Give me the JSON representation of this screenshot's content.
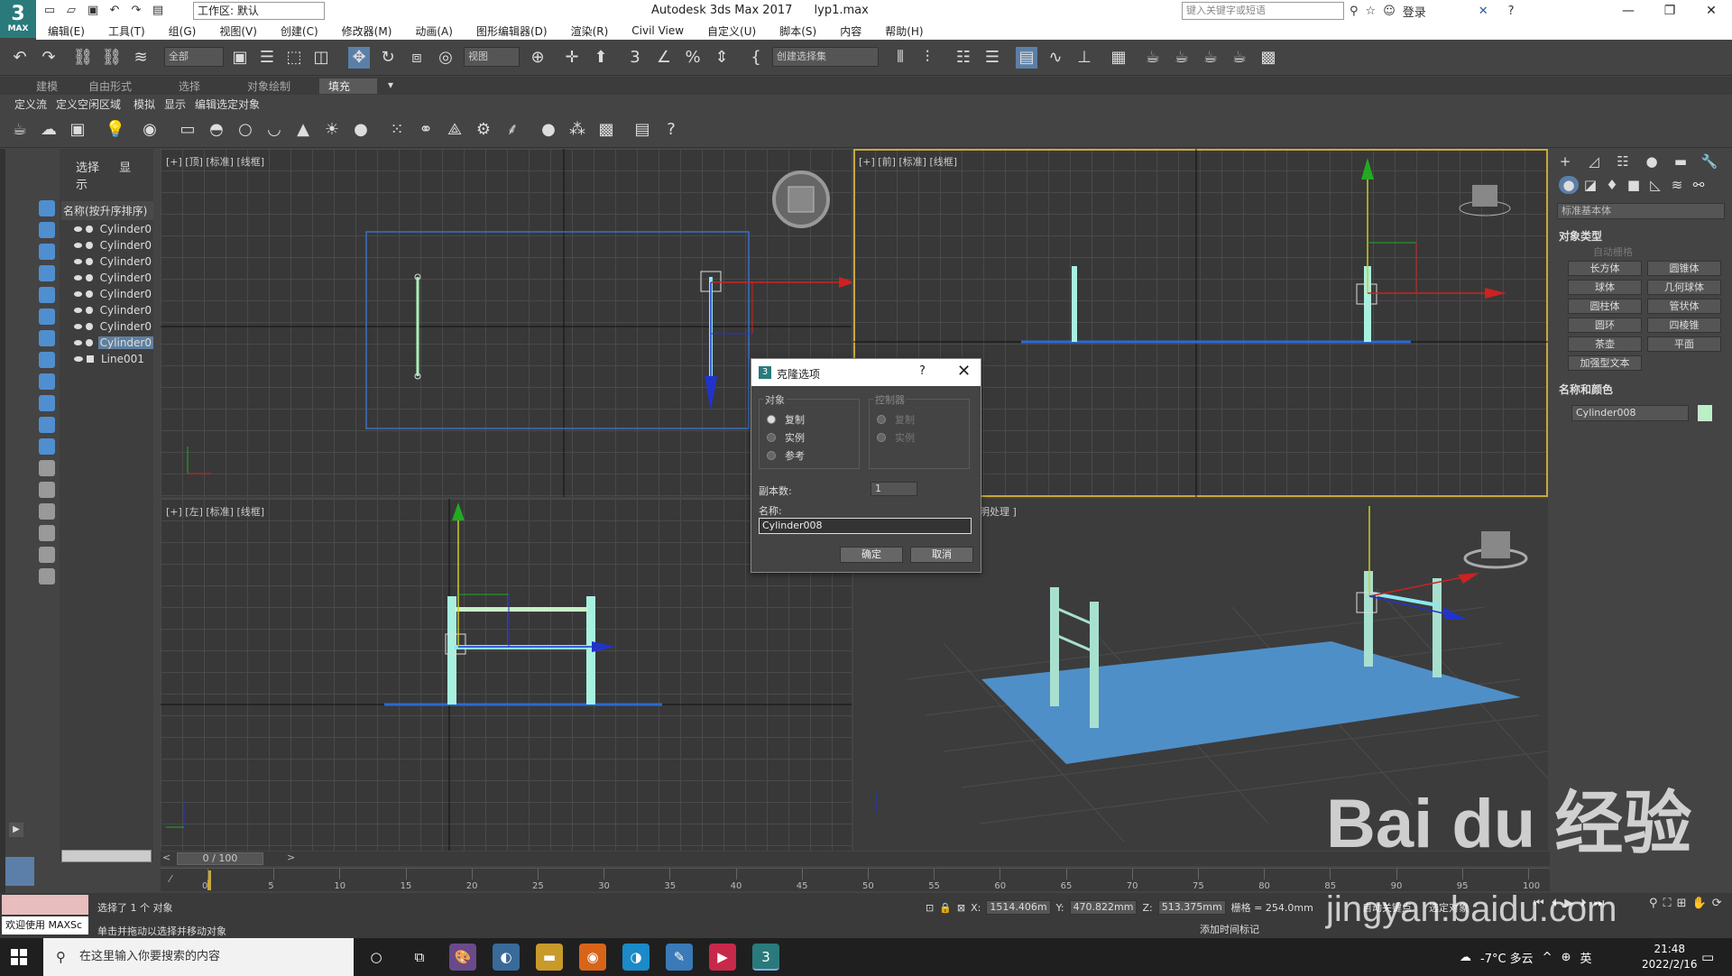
{
  "app": {
    "logo_text": "3",
    "logo_sub": "MAX",
    "workspace": "工作区: 默认",
    "title": "Autodesk 3ds Max 2017",
    "file": "lyp1.max",
    "search_placeholder": "键入关键字或短语",
    "login": "登录"
  },
  "menu": [
    "编辑(E)",
    "工具(T)",
    "组(G)",
    "视图(V)",
    "创建(C)",
    "修改器(M)",
    "动画(A)",
    "图形编辑器(D)",
    "渲染(R)",
    "Civil View",
    "自定义(U)",
    "脚本(S)",
    "内容",
    "帮助(H)"
  ],
  "toolbar": {
    "filter_dropdown": "全部",
    "view_dropdown": "视图",
    "selection_set": "创建选择集"
  },
  "ribbon": {
    "tabs": [
      "建模",
      "自由形式",
      "选择",
      "对象绘制",
      "填充"
    ],
    "active_tab": "填充",
    "subtabs": [
      "定义流",
      "定义空闲区域",
      "模拟",
      "显示",
      "编辑选定对象"
    ]
  },
  "explorer": {
    "tabs": [
      "选择",
      "显示"
    ],
    "header": "名称(按升序排序)",
    "items": [
      "Cylinder0",
      "Cylinder0",
      "Cylinder0",
      "Cylinder0",
      "Cylinder0",
      "Cylinder0",
      "Cylinder0",
      "Cylinder0",
      "Line001"
    ]
  },
  "viewports": {
    "top": "[+] [顶] [标准] [线框]",
    "front": "[+] [前] [标准] [线框]",
    "left": "[+] [左] [标准] [线框]",
    "persp": "明处理 ]"
  },
  "command_panel": {
    "category": "标准基本体",
    "rollout_object_type": "对象类型",
    "autogrid": "自动栅格",
    "buttons": [
      "长方体",
      "圆锥体",
      "球体",
      "几何球体",
      "圆柱体",
      "管状体",
      "圆环",
      "四棱锥",
      "茶壶",
      "平面",
      "加强型文本"
    ],
    "rollout_name_color": "名称和颜色",
    "object_name": "Cylinder008",
    "object_color": "#b9f0c4"
  },
  "dialog": {
    "title": "克隆选项",
    "help": "?",
    "object_group": "对象",
    "object_options": [
      "复制",
      "实例",
      "参考"
    ],
    "selected_option": "复制",
    "controller_group": "控制器",
    "controller_options": [
      "复制",
      "实例"
    ],
    "copies_label": "副本数:",
    "copies_value": "1",
    "name_label": "名称:",
    "name_value": "Cylinder008",
    "ok": "确定",
    "cancel": "取消"
  },
  "timeline": {
    "slider": "0 / 100",
    "ticks": [
      "0",
      "5",
      "10",
      "15",
      "20",
      "25",
      "30",
      "35",
      "40",
      "45",
      "50",
      "55",
      "60",
      "65",
      "70",
      "75",
      "80",
      "85",
      "90",
      "95",
      "100"
    ]
  },
  "status": {
    "maxscript": "欢迎使用 MAXSc",
    "selected": "选择了 1 个 对象",
    "hint": "单击并拖动以选择并移动对象",
    "x_label": "X:",
    "x": "1514.406m",
    "y_label": "Y:",
    "y": "470.822mm",
    "z_label": "Z:",
    "z": "513.375mm",
    "grid": "栅格 = 254.0mm",
    "add_time_tag": "添加时间标记",
    "autokey": "自动关键点",
    "set_key": "选定对象"
  },
  "taskbar": {
    "search": "在这里输入你要搜索的内容",
    "weather": "-7°C 多云",
    "ime": "英",
    "time": "21:48",
    "date": "2022/2/16"
  },
  "watermark": {
    "line1": "Bai du 经验",
    "line2": "jingyan.baidu.com"
  }
}
